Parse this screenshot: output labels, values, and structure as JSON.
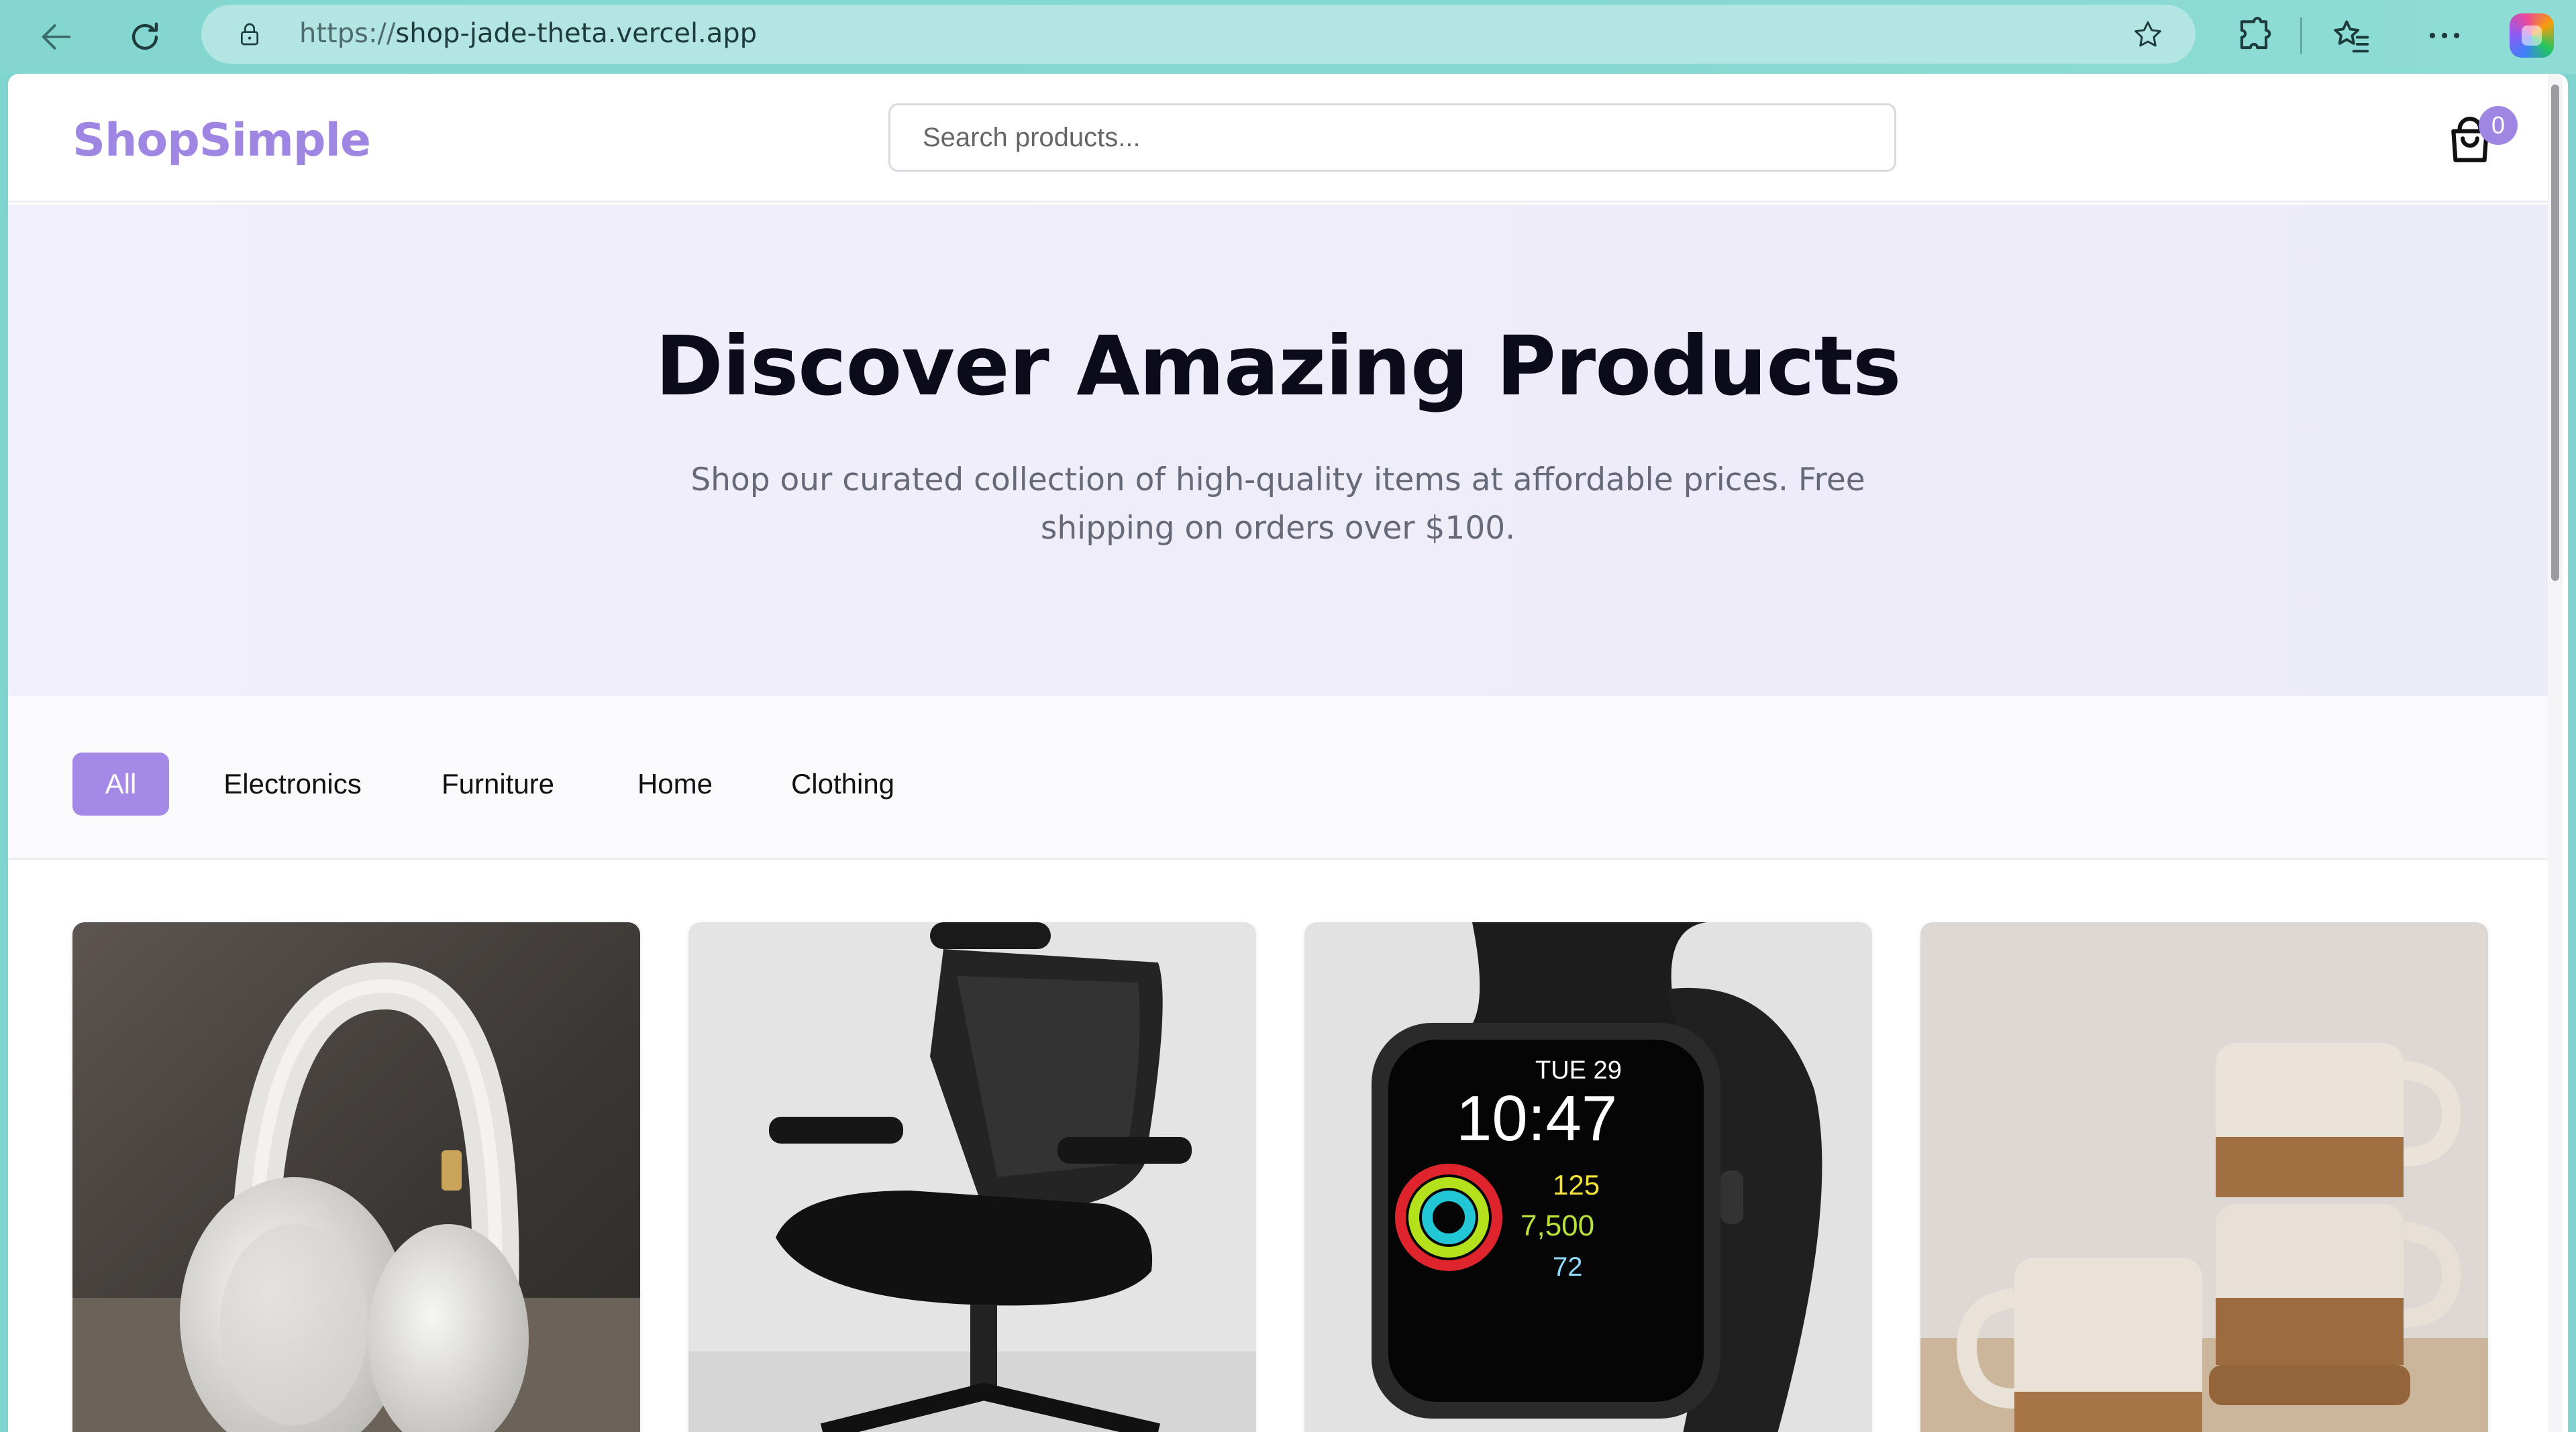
{
  "browser": {
    "url_prefix": "https://",
    "url_host": "shop-jade-theta.vercel.app"
  },
  "header": {
    "logo": "ShopSimple",
    "search_placeholder": "Search products...",
    "cart_count": "0"
  },
  "hero": {
    "title": "Discover Amazing Products",
    "subtitle": "Shop our curated collection of high-quality items at affordable prices. Free shipping on orders over $100."
  },
  "categories": [
    "All",
    "Electronics",
    "Furniture",
    "Home",
    "Clothing"
  ],
  "active_category": "All",
  "products": [
    {
      "image": "white-headphones"
    },
    {
      "image": "black-office-chair"
    },
    {
      "image": "smartwatch",
      "watch_day": "TUE 29",
      "watch_time": "10:47",
      "watch_stat1": "125",
      "watch_stat2": "7,500",
      "watch_stat3": "72"
    },
    {
      "image": "ceramic-mugs"
    }
  ],
  "colors": {
    "brand": "#9f86e3",
    "active_tab": "#a48ae6",
    "hero_bg": "#efedf8"
  }
}
